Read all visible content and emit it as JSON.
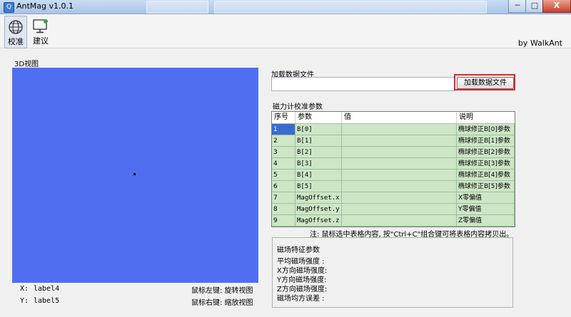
{
  "window": {
    "title": "AntMag v1.0.1",
    "app_icon": "Q",
    "minimize": "─",
    "maximize": "□",
    "close": "X"
  },
  "toolbar": {
    "calibrate_label": "校准",
    "suggest_label": "建议",
    "byline": "by WalkAnt"
  },
  "view3d": {
    "title": "3D视图",
    "x_label": "X:",
    "x_value": "label4",
    "y_label": "Y:",
    "y_value": "label5",
    "hint_left": "鼠标左键: 旋转视图",
    "hint_right": "鼠标右键: 缩放视图",
    "background": "#4f6ff0"
  },
  "load": {
    "label": "加载数据文件",
    "path_value": "",
    "button_label": "加载数据文件"
  },
  "calibration": {
    "title": "磁力计校准参数",
    "columns": [
      "序号",
      "参数",
      "值",
      "说明"
    ],
    "rows": [
      {
        "idx": "1",
        "param": "B[0]",
        "value": "",
        "desc": "椭球修正B[0]参数"
      },
      {
        "idx": "2",
        "param": "B[1]",
        "value": "",
        "desc": "椭球修正B[1]参数"
      },
      {
        "idx": "3",
        "param": "B[2]",
        "value": "",
        "desc": "椭球修正B[2]参数"
      },
      {
        "idx": "4",
        "param": "B[3]",
        "value": "",
        "desc": "椭球修正B[3]参数"
      },
      {
        "idx": "5",
        "param": "B[4]",
        "value": "",
        "desc": "椭球修正B[4]参数"
      },
      {
        "idx": "6",
        "param": "B[5]",
        "value": "",
        "desc": "椭球修正B[5]参数"
      },
      {
        "idx": "7",
        "param": "MagOffset.x",
        "value": "",
        "desc": "X零偏值"
      },
      {
        "idx": "8",
        "param": "MagOffset.y",
        "value": "",
        "desc": "Y零偏值"
      },
      {
        "idx": "9",
        "param": "MagOffset.z",
        "value": "",
        "desc": "Z零偏值"
      }
    ],
    "note": "注: 鼠标选中表格内容, 按\"Ctrl+C\"组合键可将表格内容拷贝出。"
  },
  "features": {
    "title": "磁场特征参数",
    "lines": [
      "平均磁场强度 :",
      "X方向磁场强度:",
      "Y方向磁场强度:",
      "Z方向磁场强度:",
      "磁场均方误差 :"
    ]
  }
}
